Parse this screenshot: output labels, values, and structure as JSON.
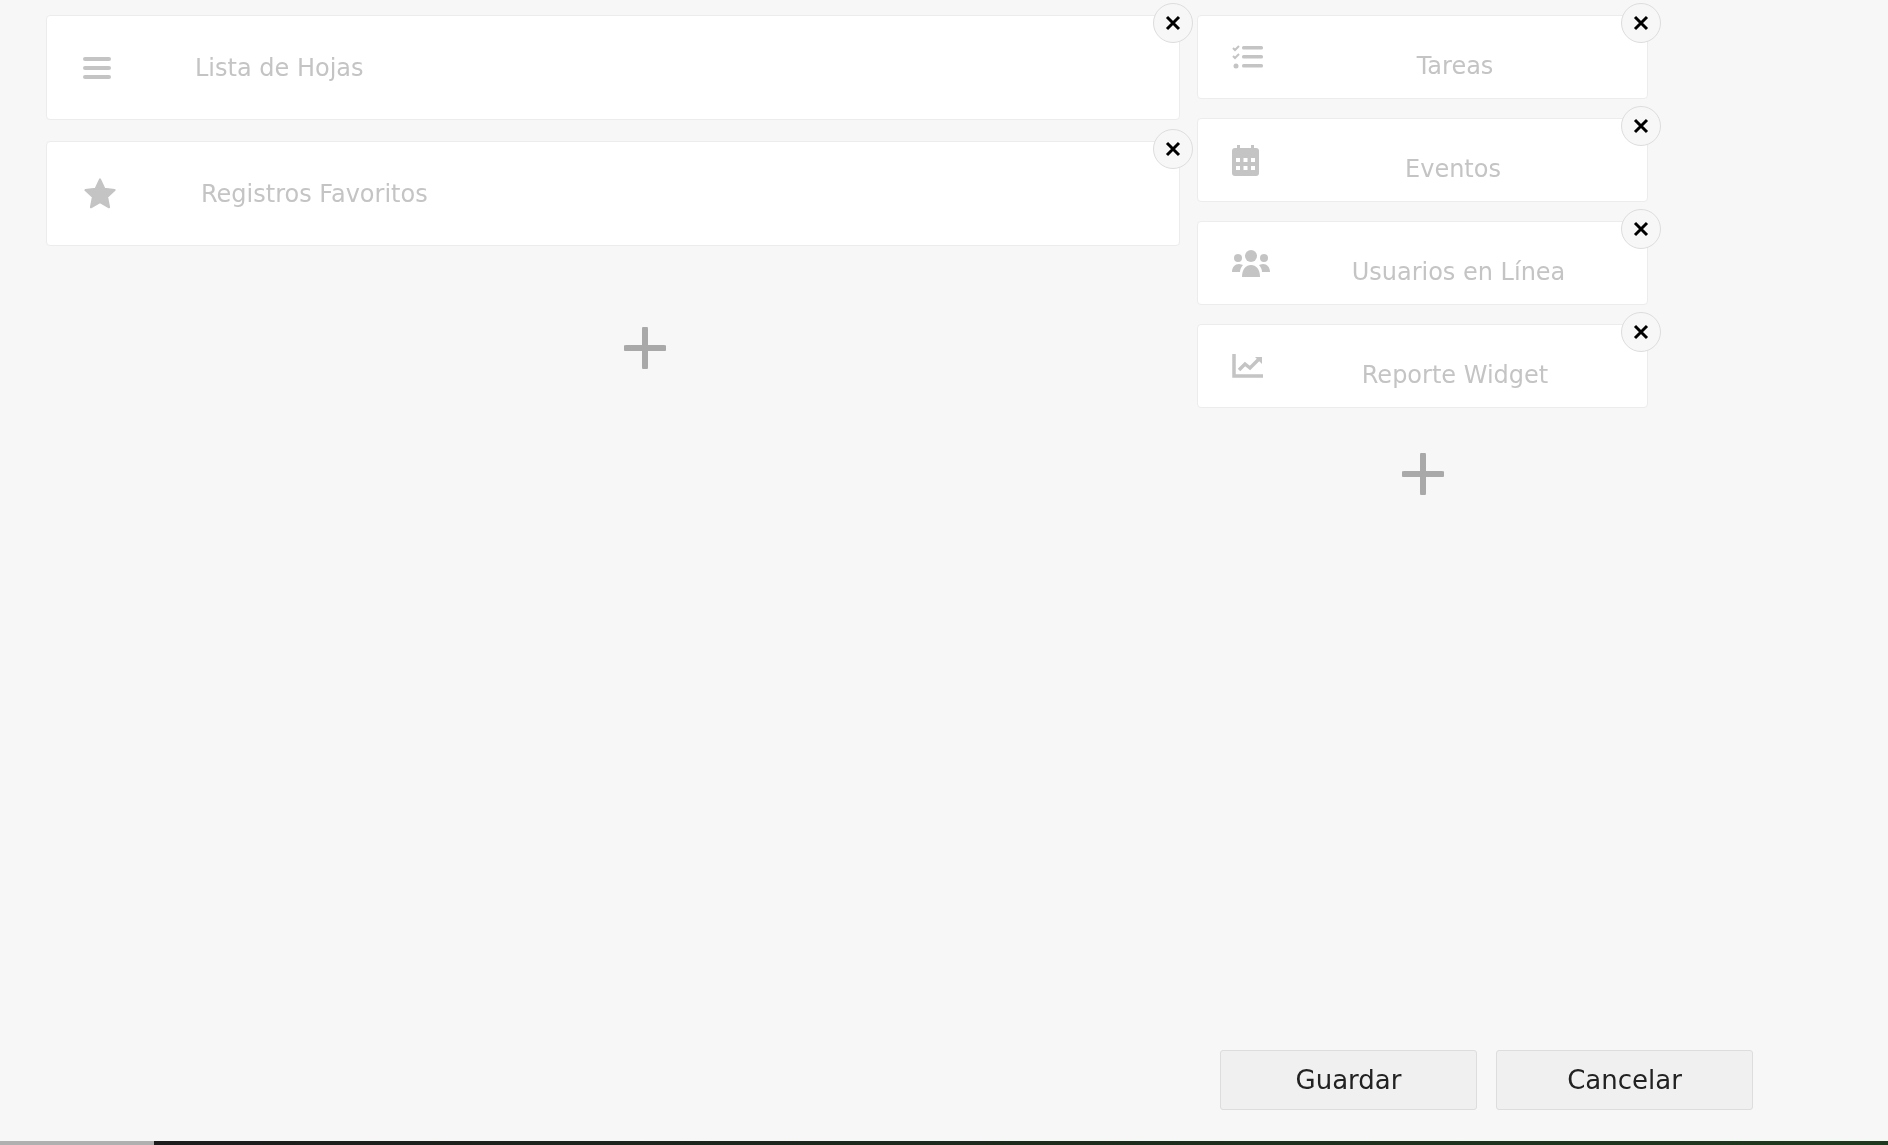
{
  "columns": [
    {
      "widgets": [
        {
          "kind": "list",
          "title": "Lista de Hojas"
        },
        {
          "kind": "star",
          "title": "Registros Favoritos"
        }
      ]
    },
    {
      "widgets": [
        {
          "kind": "tasks",
          "title": "Tareas"
        },
        {
          "kind": "calendar",
          "title": "Eventos"
        },
        {
          "kind": "users",
          "title": "Usuarios en Línea"
        },
        {
          "kind": "chart",
          "title": "Reporte Widget"
        }
      ]
    }
  ],
  "buttons": [
    "Guardar",
    "Cancelar"
  ]
}
